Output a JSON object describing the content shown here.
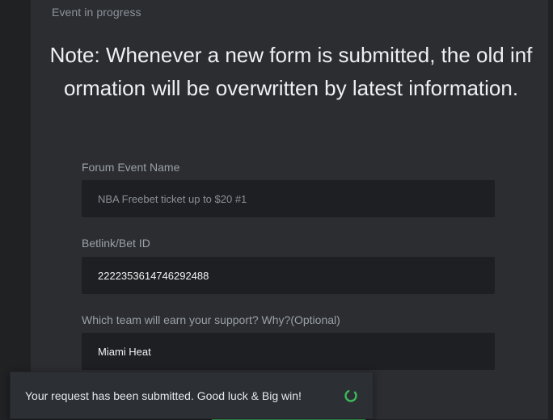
{
  "event": {
    "status": "Event in progress",
    "note": "Note: Whenever a new form is submitted, the old information will be overwritten by latest information."
  },
  "form": {
    "forum_event_name": {
      "label": "Forum Event Name",
      "value": "NBA Freebet ticket up to $20 #1"
    },
    "betlink": {
      "label": "Betlink/Bet ID",
      "value": "2222353614746292488"
    },
    "support": {
      "label": "Which team will earn your support? Why?(Optional)",
      "value": "Miami Heat"
    }
  },
  "toast": {
    "message": "Your request has been submitted. Good luck & Big win!",
    "spinner_color": "#3db85a"
  },
  "icons": {
    "spinner": "loading-spinner-icon"
  }
}
